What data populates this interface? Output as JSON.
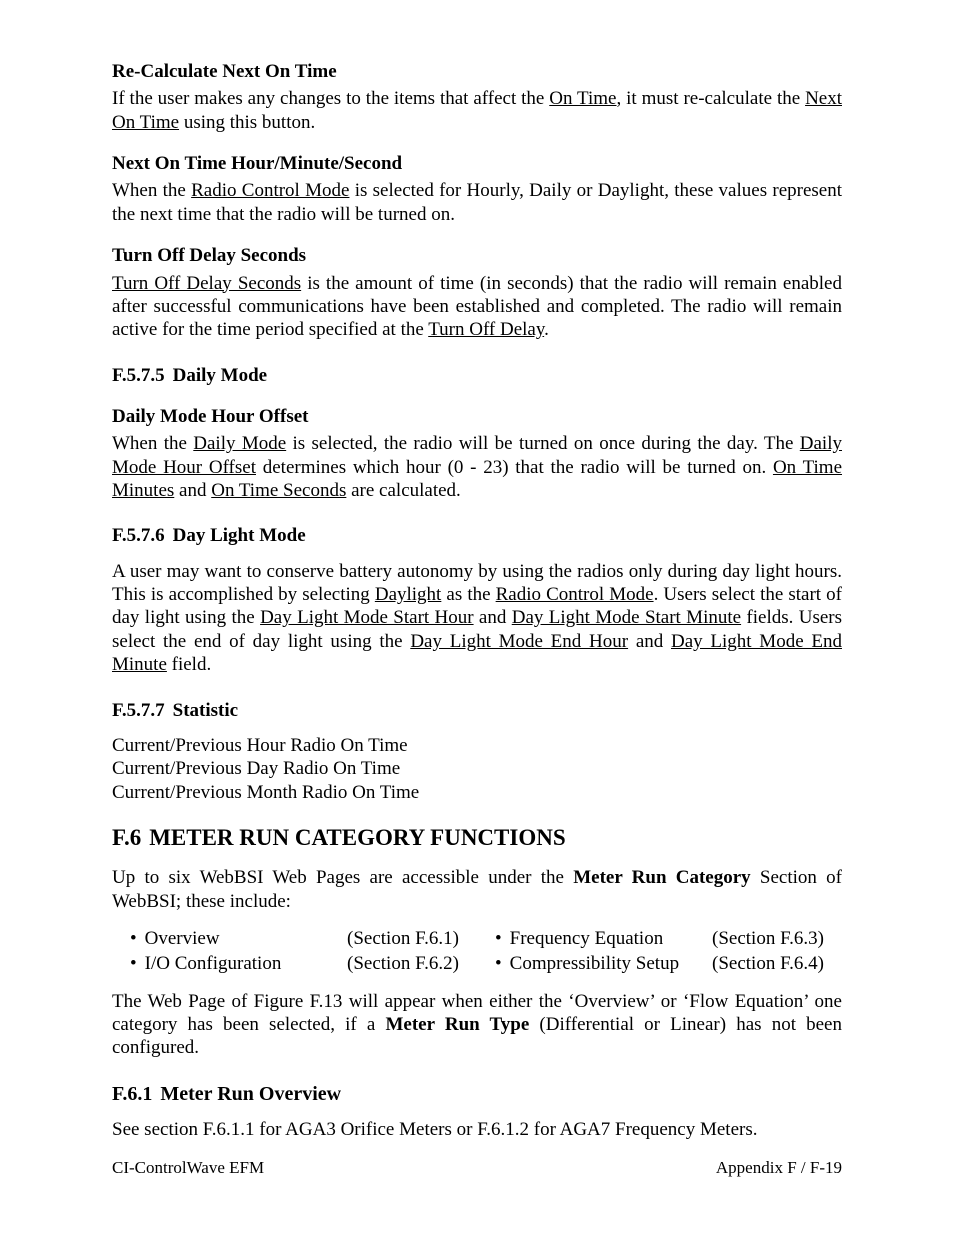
{
  "s1": {
    "h": "Re-Calculate Next On Time",
    "p_a": "If the user makes any changes to the items that affect the ",
    "p_u1": "On Time",
    "p_b": ", it must re-calculate the ",
    "p_u2": "Next On Time",
    "p_c": " using this button."
  },
  "s2": {
    "h": "Next On Time Hour/Minute/Second",
    "p_a": "When the ",
    "p_u1": "Radio Control Mode",
    "p_b": " is selected for Hourly, Daily or Daylight, these values represent the next time that the radio will be turned on."
  },
  "s3": {
    "h": "Turn Off Delay Seconds",
    "p_u1": "Turn Off Delay Seconds",
    "p_a": " is the amount of time (in seconds) that the radio will remain enabled after successful communications have been established and completed. The radio will remain active for the time period specified at the ",
    "p_u2": "Turn Off Delay",
    "p_b": "."
  },
  "s575": {
    "num": "F.5.7.5",
    "title": "Daily Mode",
    "h": "Daily Mode Hour Offset",
    "p_a": "When the ",
    "p_u1": "Daily Mode",
    "p_b": " is selected, the radio will be turned on once during the day. The ",
    "p_u2": "Daily Mode Hour Offset",
    "p_c": " determines which hour (0 - 23) that the radio will be turned on. ",
    "p_u3": "On Time Minutes",
    "p_d": " and ",
    "p_u4": "On Time Seconds",
    "p_e": " are calculated."
  },
  "s576": {
    "num": "F.5.7.6",
    "title": "Day Light Mode",
    "p_a": "A user may want to conserve battery autonomy by using the radios only during day light hours. This is accomplished by selecting ",
    "p_u1": "Daylight",
    "p_b": " as the ",
    "p_u2": "Radio Control Mode",
    "p_c": ". Users select the start of day light using the ",
    "p_u3": "Day Light Mode Start Hour",
    "p_d": " and ",
    "p_u4": "Day Light Mode Start Minute",
    "p_e": "  fields. Users select the end of day light using the ",
    "p_u5": "Day Light Mode End Hour",
    "p_f": " and ",
    "p_u6": "Day Light Mode End Minute",
    "p_g": " field."
  },
  "s577": {
    "num": "F.5.7.7",
    "title": "Statistic",
    "l1": "Current/Previous Hour Radio On Time",
    "l2": "Current/Previous Day Radio On Time",
    "l3": "Current/Previous Month Radio On Time"
  },
  "f6": {
    "num": "F.6",
    "title": "METER RUN CATEGORY FUNCTIONS",
    "p_a": "Up to six WebBSI Web Pages are accessible under the ",
    "p_b1": "Meter Run Category",
    "p_b": " Section of WebBSI; these include:",
    "items": {
      "0": {
        "label": "Overview",
        "ref": "(Section F.6.1)"
      },
      "1": {
        "label": "Frequency Equation",
        "ref": "(Section F.6.3)"
      },
      "2": {
        "label": "I/O Configuration",
        "ref": "(Section F.6.2)"
      },
      "3": {
        "label": "Compressibility Setup",
        "ref": "(Section F.6.4)"
      }
    },
    "p2_a": "The Web Page of Figure F.13 will appear when either the ‘Overview’ or ‘Flow Equation’ one category has been selected, if a ",
    "p2_b1": "Meter Run Type",
    "p2_b": " (Differential or Linear) has not been configured."
  },
  "f61": {
    "num": "F.6.1",
    "title": "Meter Run Overview",
    "p": "See section F.6.1.1 for AGA3 Orifice Meters or F.6.1.2 for AGA7 Frequency Meters."
  },
  "footer": {
    "left": "CI-ControlWave EFM",
    "right": "Appendix F / F-19"
  },
  "bullet": "•"
}
